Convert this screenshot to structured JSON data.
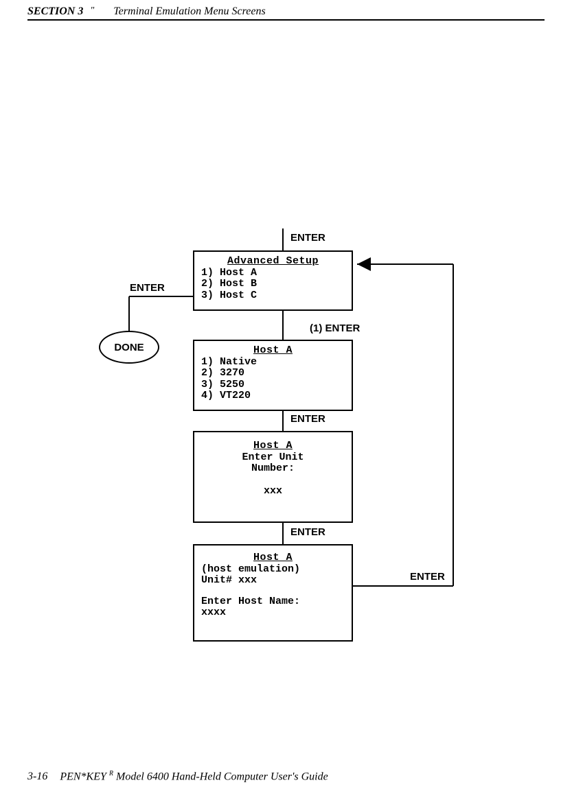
{
  "header": {
    "section": "SECTION 3",
    "quote": "\"",
    "title": "Terminal Emulation Menu Screens"
  },
  "footer": {
    "page": "3-16",
    "product_a": "PEN*KEY",
    "sup": "R",
    "product_b": " Model 6400 Hand-Held Computer User's Guide"
  },
  "labels": {
    "enter_top": "ENTER",
    "enter_left": "ENTER",
    "one_enter": "(1) ENTER",
    "enter_mid1": "ENTER",
    "enter_mid2": "ENTER",
    "enter_right": "ENTER",
    "done": "DONE"
  },
  "box1": {
    "title": "Advanced Setup",
    "l1": "1) Host A",
    "l2": "2) Host B",
    "l3": "3) Host C"
  },
  "box2": {
    "title": "Host  A",
    "l1": "1) Native",
    "l2": "2) 3270",
    "l3": "3) 5250",
    "l4": "4) VT220"
  },
  "box3": {
    "title": "Host  A",
    "l1": "Enter Unit",
    "l2": "Number:",
    "l3": "xxx"
  },
  "box4": {
    "title": "Host  A",
    "l1": "(host emulation)",
    "l2": "Unit#  xxx",
    "l3": "Enter Host Name:",
    "l4": "xxxx"
  }
}
